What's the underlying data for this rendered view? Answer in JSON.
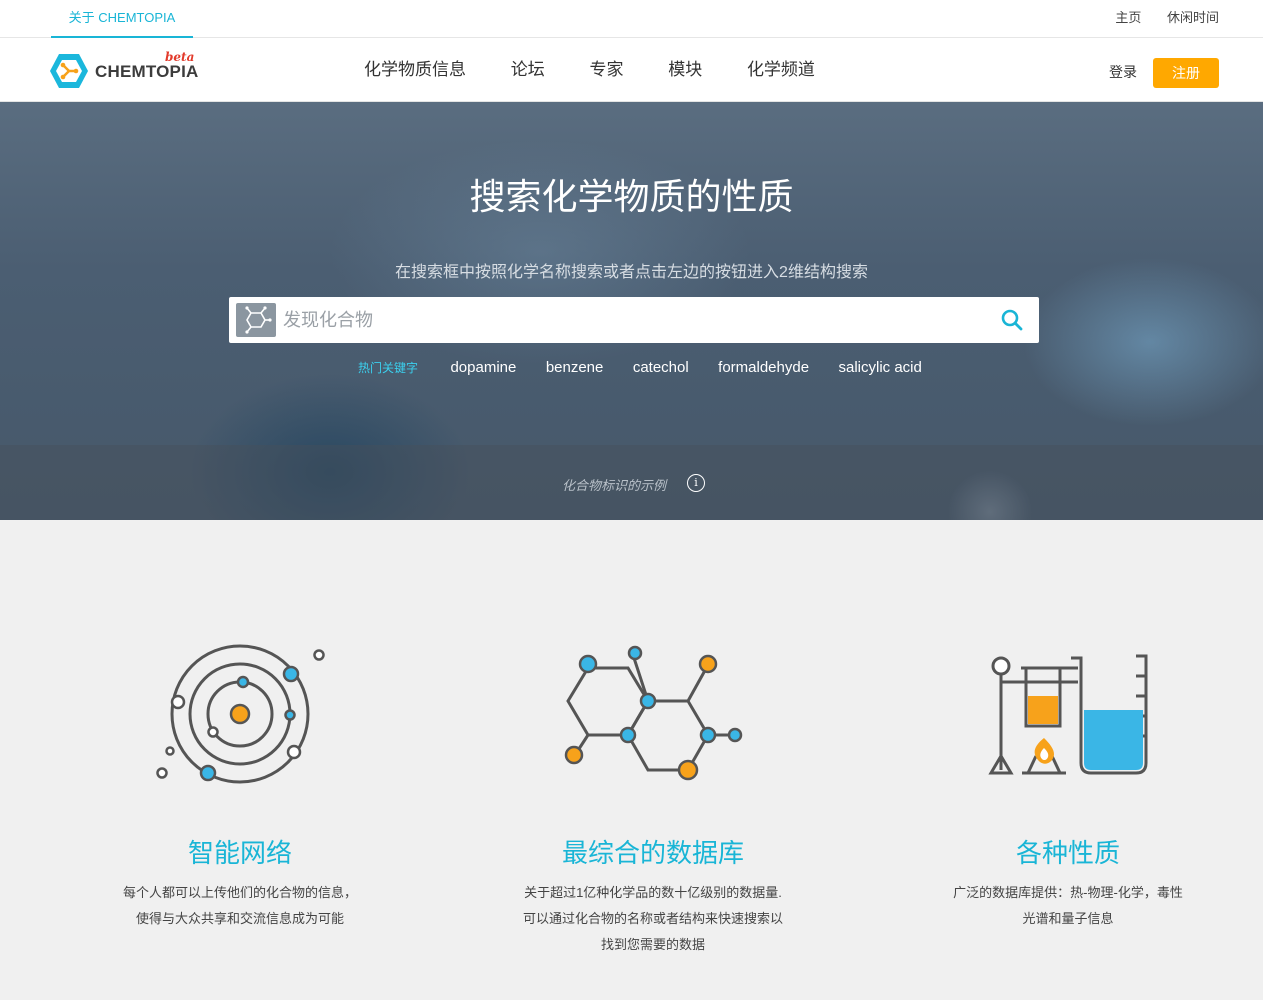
{
  "topbar": {
    "about": "关于 CHEMTOPIA",
    "home": "主页",
    "leisure": "休闲时间"
  },
  "header": {
    "brand": "CHEMTOPIA",
    "beta": "beta",
    "nav": [
      "化学物质信息",
      "论坛",
      "专家",
      "模块",
      "化学频道"
    ],
    "login": "登录",
    "signup": "注册"
  },
  "hero": {
    "title": "搜索化学物质的性质",
    "subtitle": "在搜索框中按照化学名称搜索或者点击左边的按钮进入2维结构搜索",
    "search_placeholder": "发现化合物",
    "hot_label": "热门关键字",
    "keywords": [
      "dopamine",
      "benzene",
      "catechol",
      "formaldehyde",
      "salicylic acid"
    ],
    "example_label": "化合物标识的示例",
    "info_glyph": "i"
  },
  "features": [
    {
      "icon": "network-orbit-icon",
      "title": "智能网络",
      "desc_lines": [
        "每个人都可以上传他们的化合物的信息，",
        "使得与大众共享和交流信息成为可能"
      ]
    },
    {
      "icon": "molecule-structure-icon",
      "title": "最综合的数据库",
      "desc_lines": [
        "关于超过1亿种化学品的数十亿级别的数据量.",
        "可以通过化合物的名称或者结构来快速搜索以",
        "找到您需要的数据"
      ]
    },
    {
      "icon": "lab-equipment-icon",
      "title": "各种性质",
      "desc_lines": [
        "广泛的数据库提供：热-物理-化学，毒性",
        "光谱和量子信息"
      ]
    }
  ],
  "colors": {
    "accent": "#19b5d6",
    "signup": "#ffa800",
    "orange": "#f7a21b",
    "blue": "#3ab6e6",
    "icon_stroke": "#555555"
  }
}
